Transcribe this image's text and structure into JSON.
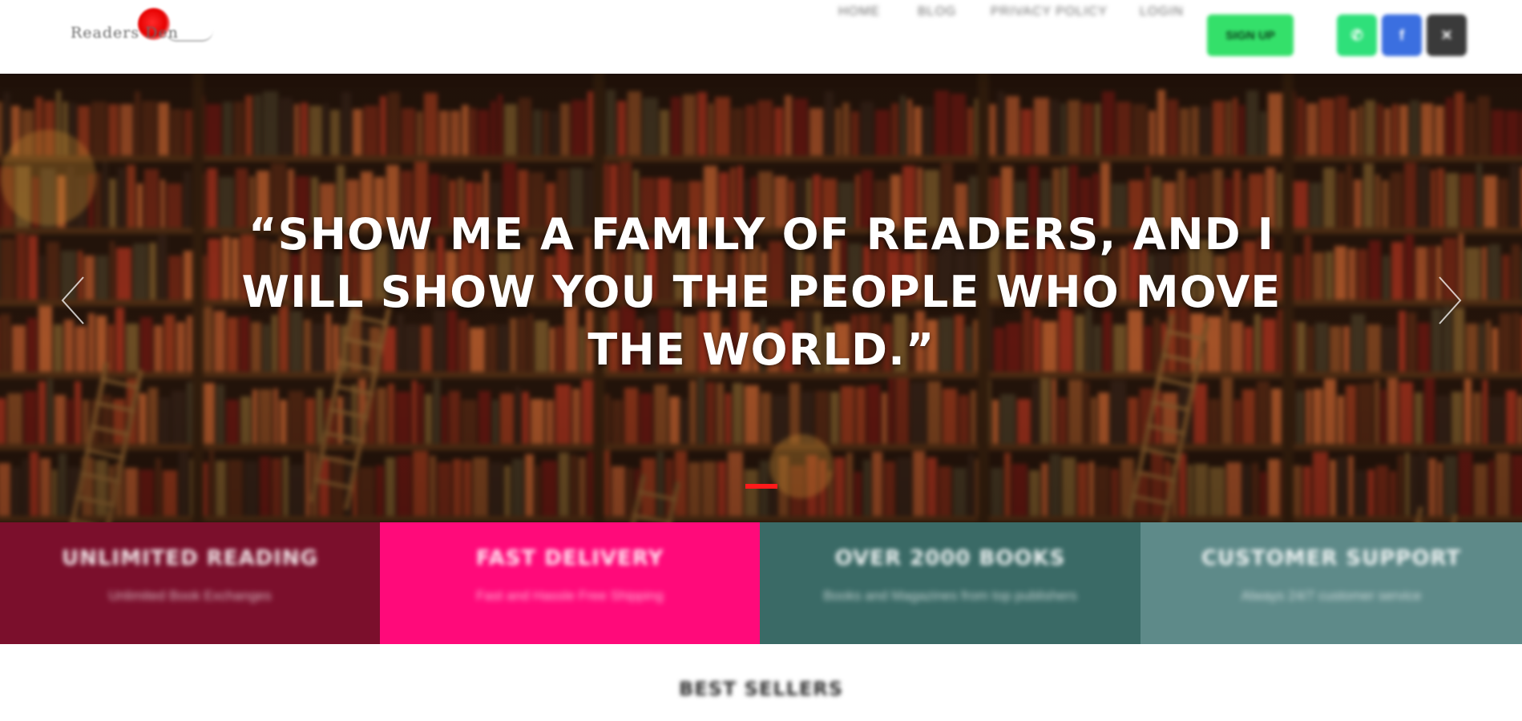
{
  "header": {
    "logo_text": "Readers Den",
    "nav": [
      {
        "label": "HOME"
      },
      {
        "label": "BLOG"
      },
      {
        "label": "PRIVACY POLICY"
      },
      {
        "label": "LOGIN"
      }
    ],
    "cta_label": "SIGN UP",
    "social": [
      {
        "name": "whatsapp-icon",
        "glyph": "✆",
        "color": "#2fe07a"
      },
      {
        "name": "facebook-icon",
        "glyph": "f",
        "color": "#3b6fe0"
      },
      {
        "name": "twitter-icon",
        "glyph": "✕",
        "color": "#3a3a3a"
      }
    ]
  },
  "hero": {
    "quote": "“SHOW ME A FAMILY OF READERS, AND I WILL SHOW YOU THE PEOPLE WHO MOVE THE WORLD.”",
    "prev_icon": "chevron-left-icon",
    "next_icon": "chevron-right-icon",
    "indicator_color": "#ff1a1a"
  },
  "features": [
    {
      "title": "UNLIMITED READING",
      "subtitle": "Unlimited Book Exchanges",
      "color": "#7b0f2c"
    },
    {
      "title": "FAST DELIVERY",
      "subtitle": "Fast and Hassle Free Shipping",
      "color": "#ff0a7a"
    },
    {
      "title": "OVER 2000 BOOKS",
      "subtitle": "Books and Magazines from top publishers",
      "color": "#3a6a66"
    },
    {
      "title": "CUSTOMER SUPPORT",
      "subtitle": "Always 24/7 customer service",
      "color": "#5e8a89"
    }
  ],
  "best_sellers": {
    "title": "BEST SELLERS"
  }
}
